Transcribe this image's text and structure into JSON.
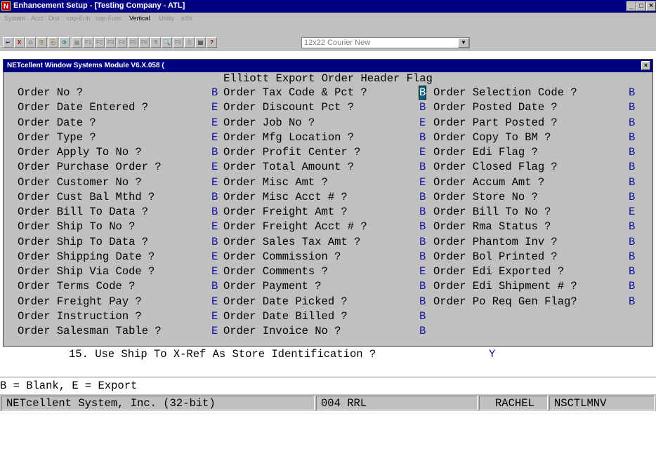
{
  "window": {
    "title": "Enhancement Setup - [Testing Company - ATL]",
    "app_icon_letter": "N",
    "buttons": {
      "minimize": "_",
      "maximize": "□",
      "close": "×"
    }
  },
  "menu": [
    "System",
    "Acct",
    "Dist",
    "cop-Enh",
    "cop-Func",
    "Vertical",
    "Utility",
    "eXit"
  ],
  "toolbar": {
    "buttons": [
      "↵",
      "X",
      "□",
      "⎘",
      "⎗",
      "⚙",
      "▦",
      "F1",
      "F2",
      "F3",
      "F4",
      "F5",
      "F6",
      "⚗",
      "🔍",
      "F9",
      "⎙",
      "▤",
      "?"
    ],
    "font_select": "12x22 Courier New",
    "dropdown_arrow": "▼"
  },
  "dialog": {
    "title": "NETcellent Window Systems Module V6.X.058 (",
    "close": "×",
    "heading": "Elliott Export Order Header Flag",
    "columns": [
      [
        {
          "label": "Order No ?",
          "value": "B"
        },
        {
          "label": "Order Date Entered ?",
          "value": "E"
        },
        {
          "label": "Order Date ?",
          "value": "E"
        },
        {
          "label": "Order Type ?",
          "value": "E"
        },
        {
          "label": "Order Apply To No ?",
          "value": "B"
        },
        {
          "label": "Order Purchase Order ?",
          "value": "E"
        },
        {
          "label": "Order Customer No ?",
          "value": "E"
        },
        {
          "label": "Order Cust Bal Mthd ?",
          "value": "B"
        },
        {
          "label": "Order Bill To Data ?",
          "value": "B"
        },
        {
          "label": "Order Ship To No ?",
          "value": "E"
        },
        {
          "label": "Order Ship To Data ?",
          "value": "B"
        },
        {
          "label": "Order Shipping Date ?",
          "value": "E"
        },
        {
          "label": "Order Ship Via Code ?",
          "value": "E"
        },
        {
          "label": "Order Terms Code ?",
          "value": "B"
        },
        {
          "label": "Order Freight Pay ?",
          "value": "E"
        },
        {
          "label": "Order Instruction ?",
          "value": "E"
        },
        {
          "label": "Order Salesman Table ?",
          "value": "E"
        }
      ],
      [
        {
          "label": "Order Tax Code & Pct ?",
          "value": "B"
        },
        {
          "label": "Order Discount Pct ?",
          "value": "B"
        },
        {
          "label": "Order Job No ?",
          "value": "E"
        },
        {
          "label": "Order Mfg Location ?",
          "value": "B"
        },
        {
          "label": "Order Profit Center ?",
          "value": "E"
        },
        {
          "label": "Order Total Amount ?",
          "value": "B"
        },
        {
          "label": "Order Misc Amt ?",
          "value": "E"
        },
        {
          "label": "Order Misc Acct # ?",
          "value": "B"
        },
        {
          "label": "Order Freight Amt ?",
          "value": "B"
        },
        {
          "label": "Order Freight Acct # ?",
          "value": "B"
        },
        {
          "label": "Order Sales Tax Amt ?",
          "value": "B"
        },
        {
          "label": "Order Commission ?",
          "value": "B"
        },
        {
          "label": "Order Comments ?",
          "value": "E"
        },
        {
          "label": "Order Payment ?",
          "value": "B"
        },
        {
          "label": "Order Date Picked ?",
          "value": "B"
        },
        {
          "label": "Order Date Billed ?",
          "value": "B"
        },
        {
          "label": "Order Invoice No ?",
          "value": "B"
        }
      ],
      [
        {
          "label": "Order Selection Code ?",
          "value": "B"
        },
        {
          "label": "Order Posted Date ?",
          "value": "B"
        },
        {
          "label": "Order Part Posted ?",
          "value": "B"
        },
        {
          "label": "Order Copy To BM ?",
          "value": "B"
        },
        {
          "label": "Order Edi Flag ?",
          "value": "B"
        },
        {
          "label": "Order Closed Flag ?",
          "value": "B"
        },
        {
          "label": "Order Accum Amt ?",
          "value": "B"
        },
        {
          "label": "Order Store No ?",
          "value": "B"
        },
        {
          "label": "Order Bill To No ?",
          "value": "E"
        },
        {
          "label": "Order Rma Status ?",
          "value": "B"
        },
        {
          "label": "Order Phantom Inv ?",
          "value": "B"
        },
        {
          "label": "Order Bol Printed ?",
          "value": "B"
        },
        {
          "label": "Order Edi Exported ?",
          "value": "B"
        },
        {
          "label": "Order Edi Shipment # ?",
          "value": "B"
        },
        {
          "label": "Order Po Req Gen Flag?",
          "value": "B"
        }
      ]
    ]
  },
  "background": {
    "line15": "15. Use Ship To X-Ref As Store Identification ?",
    "line15_value": "Y",
    "legend": "B = Blank, E = Export"
  },
  "status": {
    "company": "NETcellent System, Inc. (32-bit)",
    "terminal": "004 RRL",
    "user": "RACHEL",
    "program": "NSCTLMNV"
  }
}
